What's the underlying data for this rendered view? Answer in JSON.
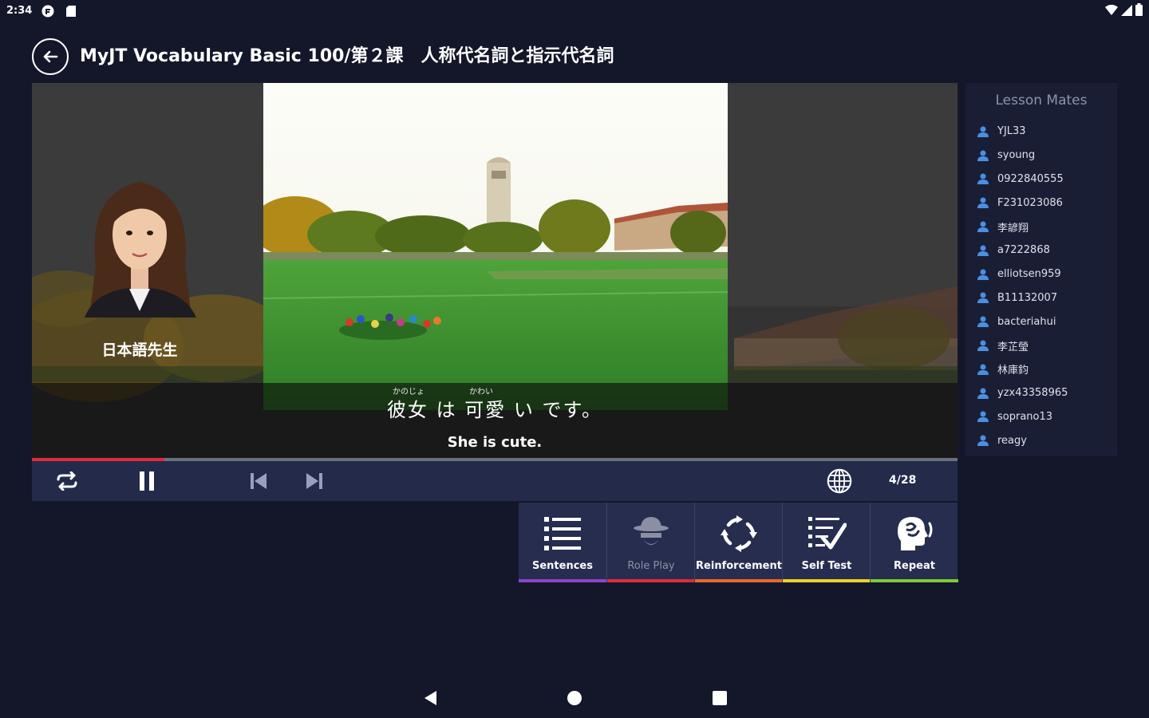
{
  "status_bar": {
    "time": "2:34"
  },
  "header": {
    "title": "MyJT Vocabulary Basic 100/第２課　人称代名詞と指示代名詞",
    "back_icon": "arrow-left-circle-icon"
  },
  "player": {
    "teacher_name": "日本語先生",
    "furigana_1": "かのじょ",
    "furigana_2": "かわい",
    "sentence_jp": "彼女 は 可愛 い です。",
    "sentence_en": "She is cute.",
    "progress": 0.143,
    "page_counter": "4/28"
  },
  "tabs": [
    {
      "label": "Sentences",
      "icon": "list-icon",
      "accent": "#8e44c9",
      "enabled": true
    },
    {
      "label": "Role Play",
      "icon": "detective-icon",
      "accent": "#e02a3c",
      "enabled": false
    },
    {
      "label": "Reinforcement",
      "icon": "refresh-cycle-icon",
      "accent": "#e8682a",
      "enabled": true
    },
    {
      "label": "Self Test",
      "icon": "checklist-icon",
      "accent": "#e8d42a",
      "enabled": true
    },
    {
      "label": "Repeat",
      "icon": "speaking-head-icon",
      "accent": "#7fc93a",
      "enabled": true
    }
  ],
  "mates": {
    "title": "Lesson Mates",
    "items": [
      "YJL33",
      "syoung",
      "0922840555",
      "F231023086",
      "李諺翔",
      "a7222868",
      "elliotsen959",
      "B11132007",
      "bacteriahui",
      "李芷瑩",
      "林庫鈞",
      "yzx43358965",
      "soprano13",
      "reagy"
    ]
  },
  "colors": {
    "background": "#141729",
    "controls": "#232a4a",
    "progress": "#e02a3c",
    "mate_icon": "#4a90e2"
  }
}
